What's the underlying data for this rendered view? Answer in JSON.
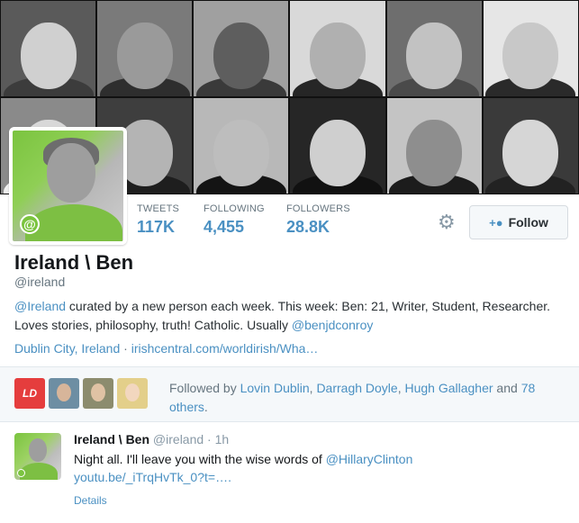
{
  "header": {
    "tiles": [
      {
        "bg": "#5a5a5a",
        "face": "#d0d0d0",
        "shoulders": "#3c3c3c"
      },
      {
        "bg": "#7a7a7a",
        "face": "#9a9a9a",
        "shoulders": "#2e2e2e"
      },
      {
        "bg": "#a0a0a0",
        "face": "#5e5e5e",
        "shoulders": "#3a3a3a"
      },
      {
        "bg": "#d9d9d9",
        "face": "#b0b0b0",
        "shoulders": "#262626"
      },
      {
        "bg": "#6e6e6e",
        "face": "#c2c2c2",
        "shoulders": "#4a4a4a"
      },
      {
        "bg": "#e6e6e6",
        "face": "#c8c8c8",
        "shoulders": "#2a2a2a"
      },
      {
        "bg": "#8a8a8a",
        "face": "#d8d8d8",
        "shoulders": "#f0f0f0"
      },
      {
        "bg": "#3e3e3e",
        "face": "#b4b4b4",
        "shoulders": "#1e1e1e"
      },
      {
        "bg": "#b8b8b8",
        "face": "#bdbdbd",
        "shoulders": "#141414"
      },
      {
        "bg": "#262626",
        "face": "#cfcfcf",
        "shoulders": "#111111"
      },
      {
        "bg": "#c4c4c4",
        "face": "#8e8e8e",
        "shoulders": "#1c1c1c"
      },
      {
        "bg": "#3a3a3a",
        "face": "#d6d6d6",
        "shoulders": "#222222"
      }
    ]
  },
  "profile": {
    "name": "Ireland \\ Ben",
    "handle": "@ireland",
    "bio_prefix_link": "@Ireland",
    "bio_text": " curated by a new person each week. This week: Ben: 21, Writer, Student, Researcher. Loves stories, philosophy, truth! Catholic. Usually ",
    "bio_suffix_link": "@benjdconroy",
    "location": "Dublin City, Ireland",
    "meta_separator": "·",
    "website": "irishcentral.com/worldirish/Wha…",
    "badge_icon": "@",
    "accent_color": "#7bc43f"
  },
  "stats": [
    {
      "label": "TWEETS",
      "value": "117K"
    },
    {
      "label": "FOLLOWING",
      "value": "4,455"
    },
    {
      "label": "FOLLOWERS",
      "value": "28.8K"
    }
  ],
  "actions": {
    "settings_icon": "gear-icon",
    "follow_label": "Follow",
    "follow_icon": "person-plus-icon"
  },
  "followed_by": {
    "avatars": [
      {
        "label": "LD",
        "bg": "#e53d3d"
      },
      {
        "bg": "#6d8ea3",
        "face": "#d7b59a"
      },
      {
        "bg": "#8c8c6e",
        "face": "#e0c2a4"
      },
      {
        "bg": "#e3cf8a",
        "face": "#f2d7bf"
      }
    ],
    "prefix": "Followed by ",
    "names": [
      "Lovin Dublin",
      "Darragh Doyle",
      "Hugh Gallagher"
    ],
    "sep1": ", ",
    "sep2": ", ",
    "and": " and ",
    "others": "78 others",
    "end": "."
  },
  "tweet": {
    "name": "Ireland \\ Ben",
    "handle": "@ireland",
    "dot": " · ",
    "time": "1h",
    "text": "Night all. I'll leave you with the wise words of ",
    "mention": "@HillaryClinton",
    "url": "youtu.be/_iTrqHvTk_0?t=….",
    "details": "Details"
  }
}
